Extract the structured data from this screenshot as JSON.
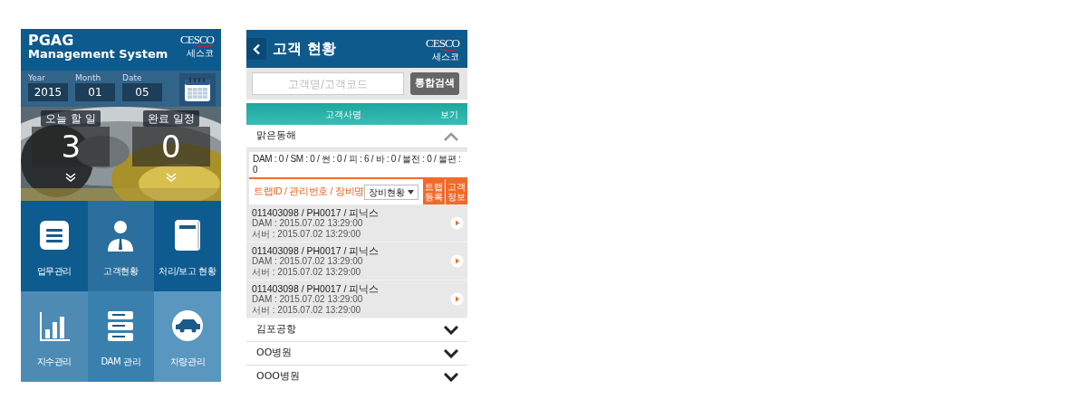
{
  "home": {
    "title": "PGAG",
    "subtitle": "Management System",
    "logo": "CESCO",
    "logo_sub": "세스코",
    "date_fields": [
      {
        "label": "Year",
        "value": "2015"
      },
      {
        "label": "Month",
        "value": "01"
      },
      {
        "label": "Date",
        "value": "05"
      }
    ],
    "stats": [
      {
        "label": "오늘 할 일",
        "value": "3"
      },
      {
        "label": "완료 일정",
        "value": "0"
      }
    ],
    "menu": [
      {
        "label": "업무관리",
        "kind": "list"
      },
      {
        "label": "고객현황",
        "kind": "person"
      },
      {
        "label": "처리/보고 현황",
        "kind": "book"
      },
      {
        "label": "지수관리",
        "kind": "chart"
      },
      {
        "label": "DAM 관리",
        "kind": "server"
      },
      {
        "label": "차량관리",
        "kind": "car"
      }
    ]
  },
  "customers": {
    "title": "고객 현황",
    "logo": "CESCO",
    "logo_sub": "세스코",
    "search": {
      "placeholder": "고객명/고객코드",
      "button": "통합검색"
    },
    "header": {
      "column_1": "고객사명",
      "column_2": "보기"
    },
    "groups": [
      {
        "name": "맑은동해",
        "expanded": true,
        "summary": "DAM : 0 / SM : 0 / 썬 : 0 / 피 : 6 / 바 : 0 / 불전 : 0 /  불편 : 0",
        "filter_label": "트랩ID / 관리번호 / 장비명",
        "select": "장비현황",
        "buttons": [
          "트랩 등록",
          "고객 정보"
        ],
        "devices": [
          {
            "title": "011403098 / PH0017 / 피닉스",
            "dam": "DAM : 2015.07.02 13:29:00",
            "server": "서버 : 2015.07.02 13:29:00"
          },
          {
            "title": "011403098 / PH0017 / 피닉스",
            "dam": "DAM : 2015.07.02 13:29:00",
            "server": "서버 : 2015.07.02 13:29:00"
          },
          {
            "title": "011403098 / PH0017 / 피닉스",
            "dam": "DAM : 2015.07.02 13:29:00",
            "server": "서버 : 2015.07.02 13:29:00"
          }
        ]
      },
      {
        "name": "김포공항",
        "expanded": false
      },
      {
        "name": "OO병원",
        "expanded": false
      },
      {
        "name": "OOO병원",
        "expanded": false
      }
    ]
  }
}
